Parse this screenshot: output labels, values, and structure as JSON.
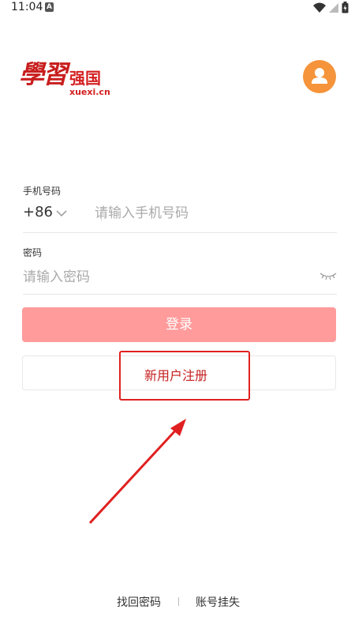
{
  "status_bar": {
    "time": "11:04",
    "notification": "A",
    "icons": [
      "wifi-icon",
      "signal-icon",
      "battery-icon"
    ]
  },
  "header": {
    "logo_script": "學習",
    "logo_cn": "强国",
    "logo_url": "xuexi.cn",
    "avatar_icon": "user-icon"
  },
  "form": {
    "phone_label": "手机号码",
    "country_code": "+86",
    "phone_placeholder": "请输入手机号码",
    "password_label": "密码",
    "password_placeholder": "请输入密码",
    "eye_icon": "eye-closed-icon"
  },
  "buttons": {
    "login": "登录",
    "register": "新用户注册"
  },
  "footer": {
    "recover_password": "找回密码",
    "report_lost": "账号挂失"
  },
  "colors": {
    "brand_red": "#d41f1f",
    "avatar_orange": "#f5943a",
    "login_disabled": "#ff9b9b",
    "annotation_red": "#e02020"
  }
}
